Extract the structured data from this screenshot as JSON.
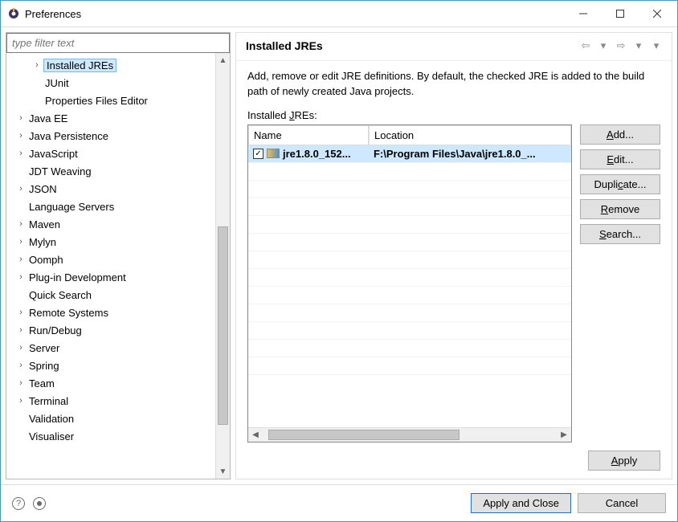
{
  "window": {
    "title": "Preferences",
    "min_label": "Minimize",
    "max_label": "Maximize",
    "close_label": "Close"
  },
  "filter": {
    "placeholder": "type filter text"
  },
  "tree": {
    "items": [
      {
        "indent": 1,
        "exp": "›",
        "label": "Installed JREs",
        "sel": true
      },
      {
        "indent": 1,
        "exp": "",
        "label": "JUnit"
      },
      {
        "indent": 1,
        "exp": "",
        "label": "Properties Files Editor"
      },
      {
        "indent": 0,
        "exp": "›",
        "label": "Java EE"
      },
      {
        "indent": 0,
        "exp": "›",
        "label": "Java Persistence"
      },
      {
        "indent": 0,
        "exp": "›",
        "label": "JavaScript"
      },
      {
        "indent": 0,
        "exp": "",
        "label": "JDT Weaving"
      },
      {
        "indent": 0,
        "exp": "›",
        "label": "JSON"
      },
      {
        "indent": 0,
        "exp": "",
        "label": "Language Servers"
      },
      {
        "indent": 0,
        "exp": "›",
        "label": "Maven"
      },
      {
        "indent": 0,
        "exp": "›",
        "label": "Mylyn"
      },
      {
        "indent": 0,
        "exp": "›",
        "label": "Oomph"
      },
      {
        "indent": 0,
        "exp": "›",
        "label": "Plug-in Development"
      },
      {
        "indent": 0,
        "exp": "",
        "label": "Quick Search"
      },
      {
        "indent": 0,
        "exp": "›",
        "label": "Remote Systems"
      },
      {
        "indent": 0,
        "exp": "›",
        "label": "Run/Debug"
      },
      {
        "indent": 0,
        "exp": "›",
        "label": "Server"
      },
      {
        "indent": 0,
        "exp": "›",
        "label": "Spring"
      },
      {
        "indent": 0,
        "exp": "›",
        "label": "Team"
      },
      {
        "indent": 0,
        "exp": "›",
        "label": "Terminal"
      },
      {
        "indent": 0,
        "exp": "",
        "label": "Validation"
      },
      {
        "indent": 0,
        "exp": "",
        "label": "Visualiser"
      }
    ]
  },
  "page": {
    "title": "Installed JREs",
    "description": "Add, remove or edit JRE definitions. By default, the checked JRE is added to the build path of newly created Java projects.",
    "list_label_pre": "Installed ",
    "list_label_key": "J",
    "list_label_post": "REs:",
    "columns": {
      "c1": "Name",
      "c2": "Location"
    },
    "rows": [
      {
        "checked": true,
        "name": "jre1.8.0_152...",
        "location": "F:\\Program Files\\Java\\jre1.8.0_..."
      }
    ],
    "buttons": {
      "add": "Add...",
      "add_u": "A",
      "edit": "Edit...",
      "edit_u": "E",
      "dup_pre": "Dupli",
      "dup_u": "c",
      "dup_post": "ate...",
      "remove": "Remove",
      "remove_u": "R",
      "search": "Search...",
      "search_u": "S",
      "apply": "Apply",
      "apply_u": "A"
    }
  },
  "footer": {
    "apply_close": "Apply and Close",
    "cancel": "Cancel"
  }
}
